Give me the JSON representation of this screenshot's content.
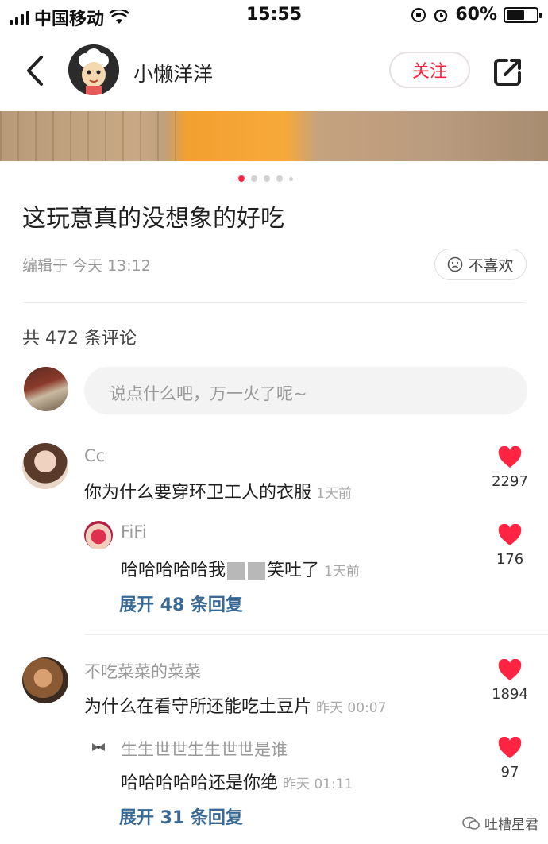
{
  "status_bar": {
    "carrier": "中国移动",
    "time": "15:55",
    "battery": "60%",
    "battery_level": 0.6
  },
  "header": {
    "author": "小懒洋洋",
    "follow_label": "关注"
  },
  "post": {
    "image_dots": 5,
    "active_dot": 0,
    "title": "这玩意真的没想象的好吃",
    "edit_time": "编辑于 今天 13:12",
    "dislike_label": "不喜欢"
  },
  "comments_section": {
    "count_label": "共 472 条评论",
    "input_placeholder": "说点什么吧，万一火了呢~"
  },
  "comments": [
    {
      "user": "Cc",
      "text": "你为什么要穿环卫工人的衣服",
      "time": "1天前",
      "likes": "2297",
      "reply": {
        "user": "FiFi",
        "text_before": "哈哈哈哈哈我",
        "text_after": "笑吐了",
        "time": "1天前",
        "likes": "176"
      },
      "expand": "展开 48 条回复"
    },
    {
      "user": "不吃菜菜的菜菜",
      "text": "为什么在看守所还能吃土豆片",
      "time": "昨天 00:07",
      "likes": "1894",
      "reply": {
        "user": "生生世世生生世世是谁",
        "text": "哈哈哈哈哈还是你绝",
        "time": "昨天 01:11",
        "likes": "97"
      },
      "expand": "展开 31 条回复"
    }
  ],
  "watermark": "吐槽星君",
  "colors": {
    "accent": "#ff2442",
    "link": "#3a6a94"
  }
}
